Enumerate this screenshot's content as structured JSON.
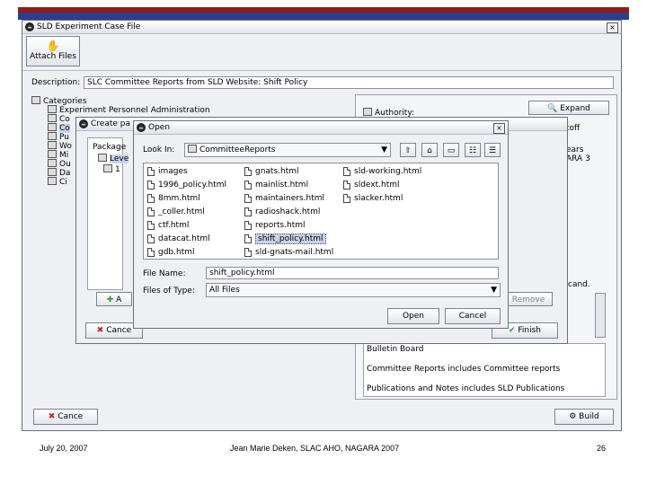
{
  "colors": {
    "accent_top": "#8b1e1e",
    "header_blue": "#2c3f8a",
    "finish_green": "#2f9b2f",
    "remove_red": "#cc2222"
  },
  "main_window": {
    "title": "SLD Experiment Case File",
    "attach_files_label": "Attach Files",
    "description_label": "Description:",
    "description_value": "SLC Committee Reports from SLD Website: Shift Policy",
    "tree": [
      "Categories",
      "Experiment Personnel Administration",
      "Co",
      "Co",
      "Pu",
      "Wo",
      "Mi",
      "Ou",
      "Da",
      "Ci"
    ],
    "authority_label": "Authority:",
    "expand_label": "Expand",
    "cancel_label": "Cance",
    "build_label": "Build",
    "right_texts": [
      "toff",
      "ears",
      "ARA 3",
      "cand."
    ],
    "desc_lines": [
      "Committee Reports includes Committee reports",
      "Publications and Notes includes SLD Publications",
      "Bulletin Board"
    ]
  },
  "create_dialog": {
    "title": "Create pa",
    "package_label": "Package",
    "tree_items": [
      "Leve",
      "1"
    ],
    "add_label": "A",
    "cancel_label": "Cance",
    "finish_label": "Finish",
    "remove_label": "Remove"
  },
  "open_dialog": {
    "title": "Open",
    "look_in_label": "Look In:",
    "look_in_value": "CommitteeReports",
    "files": [
      [
        "images",
        "gnats.html",
        "sld-working.html"
      ],
      [
        "1996_policy.html",
        "mainlist.html",
        "sldext.html"
      ],
      [
        "8mm.html",
        "maintainers.html",
        "slacker.html"
      ],
      [
        "_coller.html",
        "radioshack.html",
        ""
      ],
      [
        "ctf.html",
        "reports.html",
        ""
      ],
      [
        "datacat.html",
        "shift_policy.html",
        ""
      ],
      [
        "gdb.html",
        "sld-gnats-mail.html",
        ""
      ]
    ],
    "selected_file": "shift_policy.html",
    "file_name_label": "File Name:",
    "file_name_value": "shift_policy.html",
    "files_of_type_label": "Files of Type:",
    "files_of_type_value": "All Files",
    "open_label": "Open",
    "cancel_label": "Cancel"
  },
  "footer": {
    "date": "July 20, 2007",
    "author": "Jean Marie Deken, SLAC AHO, NAGARA 2007",
    "page": "26"
  }
}
